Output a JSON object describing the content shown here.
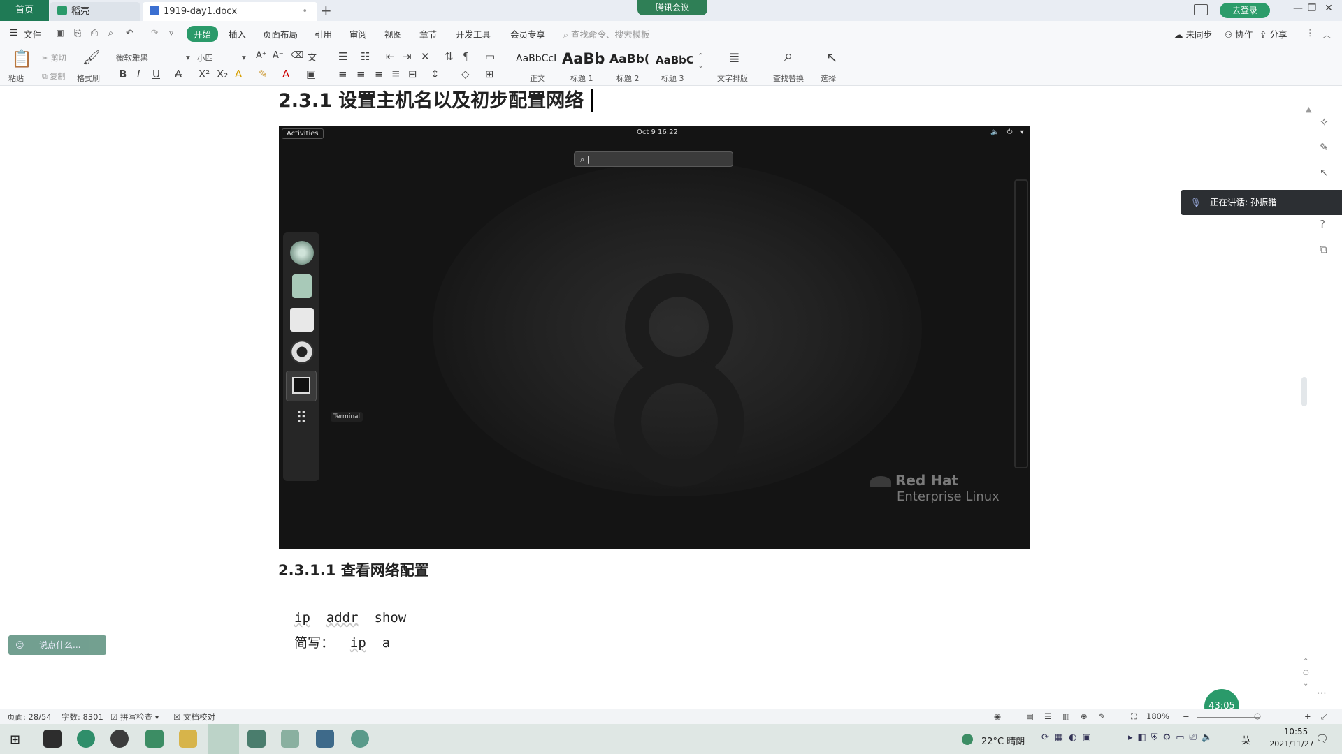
{
  "tabs": {
    "home": "首页",
    "wps": "稻壳",
    "doc": "1919-day1.docx",
    "modified_dot": "•",
    "add": "+"
  },
  "meeting_badge": "腾讯会议",
  "login": "去登录",
  "window_controls": [
    "—",
    "❐",
    "✕"
  ],
  "menu": {
    "file": "文件",
    "items": [
      "开始",
      "插入",
      "页面布局",
      "引用",
      "审阅",
      "视图",
      "章节",
      "开发工具",
      "会员专享"
    ],
    "search_placeholder": "查找命令、搜索模板",
    "right": [
      "未同步",
      "协作",
      "分享"
    ]
  },
  "ribbon": {
    "paste": "粘贴",
    "cut": "剪切",
    "copy": "复制",
    "format_painter": "格式刷",
    "font_name": "微软雅黑",
    "font_size": "小四",
    "styles": [
      {
        "preview": "AaBbCcI",
        "label": "正文"
      },
      {
        "preview": "AaBb",
        "label": "标题 1"
      },
      {
        "preview": "AaBb(",
        "label": "标题 2"
      },
      {
        "preview": "AaBbC",
        "label": "标题 3"
      }
    ],
    "text_layout": "文字排版",
    "find_replace": "查找替换",
    "select": "选择"
  },
  "document": {
    "heading_231": "2.3.1 设置主机名以及初步配置网络",
    "heading_2311": "2.3.1.1 查看网络配置",
    "code_line1": [
      "ip",
      "addr",
      "show"
    ],
    "code_line2_prefix": "简写：",
    "code_line2": [
      "ip",
      "a"
    ]
  },
  "rhel_screenshot": {
    "activities": "Activities",
    "clock": "Oct 9  16:22",
    "status_icons": "🔈 ⏻ ▾",
    "search_text": "|",
    "terminal_tooltip": "Terminal",
    "brand_line1": "Red Hat",
    "brand_line2": "Enterprise Linux"
  },
  "side_panel": {
    "speaking": "正在讲话: 孙振锴"
  },
  "say_something": "说点什么...",
  "timer": "43:05",
  "status_bar": {
    "page": "页面: 28/54",
    "words": "字数: 8301",
    "spell": "拼写检查",
    "proof": "文档校对",
    "zoom": "180%"
  },
  "taskbar": {
    "weather": "22°C 晴朗",
    "ime": "英",
    "time": "10:55",
    "date": "2021/11/27"
  }
}
